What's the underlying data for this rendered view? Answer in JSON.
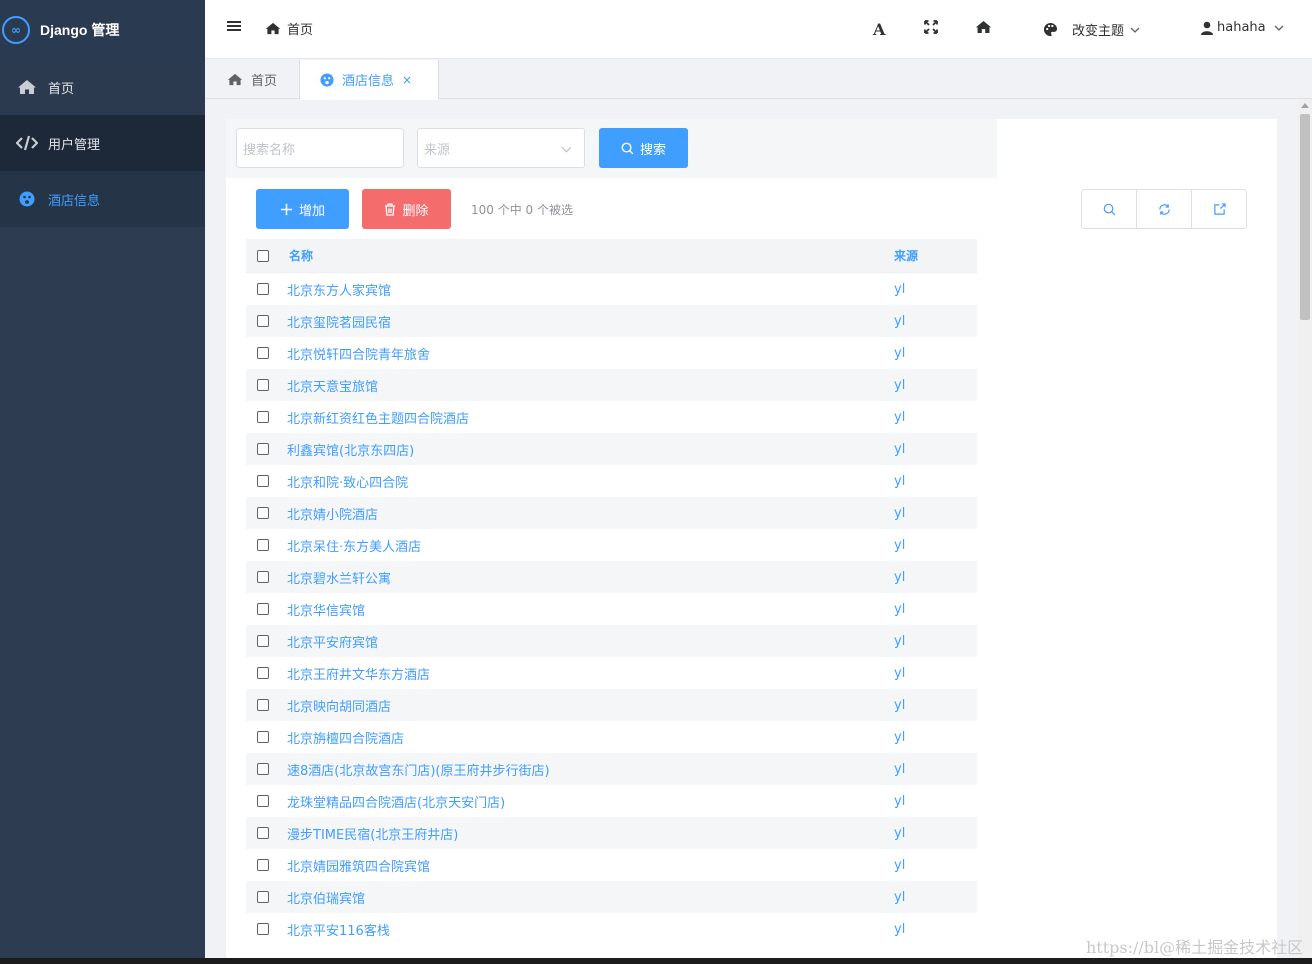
{
  "app": {
    "logo_text": "Django 管理",
    "logo_badge": "∞"
  },
  "sidebar": {
    "items": [
      {
        "label": "首页"
      },
      {
        "label": "用户管理"
      },
      {
        "label": "酒店信息"
      }
    ]
  },
  "header": {
    "breadcrumb": "首页",
    "font_icon_label": "A",
    "theme_label": "改变主题",
    "username": "hahaha"
  },
  "tabs": [
    {
      "label": "首页"
    },
    {
      "label": "酒店信息",
      "close": "×"
    }
  ],
  "search": {
    "name_placeholder": "搜索名称",
    "source_placeholder": "来源",
    "search_button": "搜索"
  },
  "toolbar": {
    "add_label": "增加",
    "delete_label": "删除",
    "selection_text": "100 个中 0 个被选"
  },
  "table": {
    "headers": {
      "name": "名称",
      "source": "来源"
    },
    "rows": [
      {
        "name": "北京东方人家宾馆",
        "source": "yl"
      },
      {
        "name": "北京玺院茗园民宿",
        "source": "yl"
      },
      {
        "name": "北京悦轩四合院青年旅舍",
        "source": "yl"
      },
      {
        "name": "北京天意宝旅馆",
        "source": "yl"
      },
      {
        "name": "北京新红资红色主题四合院酒店",
        "source": "yl"
      },
      {
        "name": "利鑫宾馆(北京东四店)",
        "source": "yl"
      },
      {
        "name": "北京和院·致心四合院",
        "source": "yl"
      },
      {
        "name": "北京婧小院酒店",
        "source": "yl"
      },
      {
        "name": "北京呆住·东方美人酒店",
        "source": "yl"
      },
      {
        "name": "北京碧水兰轩公寓",
        "source": "yl"
      },
      {
        "name": "北京华信宾馆",
        "source": "yl"
      },
      {
        "name": "北京平安府宾馆",
        "source": "yl"
      },
      {
        "name": "北京王府井文华东方酒店",
        "source": "yl"
      },
      {
        "name": "北京映向胡同酒店",
        "source": "yl"
      },
      {
        "name": "北京旃檀四合院酒店",
        "source": "yl"
      },
      {
        "name": "速8酒店(北京故宫东门店)(原王府井步行街店)",
        "source": "yl"
      },
      {
        "name": "龙珠堂精品四合院酒店(北京天安门店)",
        "source": "yl"
      },
      {
        "name": "漫步TIME民宿(北京王府井店)",
        "source": "yl"
      },
      {
        "name": "北京婧园雅筑四合院宾馆",
        "source": "yl"
      },
      {
        "name": "北京伯瑞宾馆",
        "source": "yl"
      },
      {
        "name": "北京平安116客栈",
        "source": "yl"
      }
    ]
  },
  "watermark": "https://bl@稀土掘金技术社区",
  "colors": {
    "sidebar_bg": "#2e3c51",
    "accent": "#409eff",
    "danger": "#f56c6c"
  }
}
